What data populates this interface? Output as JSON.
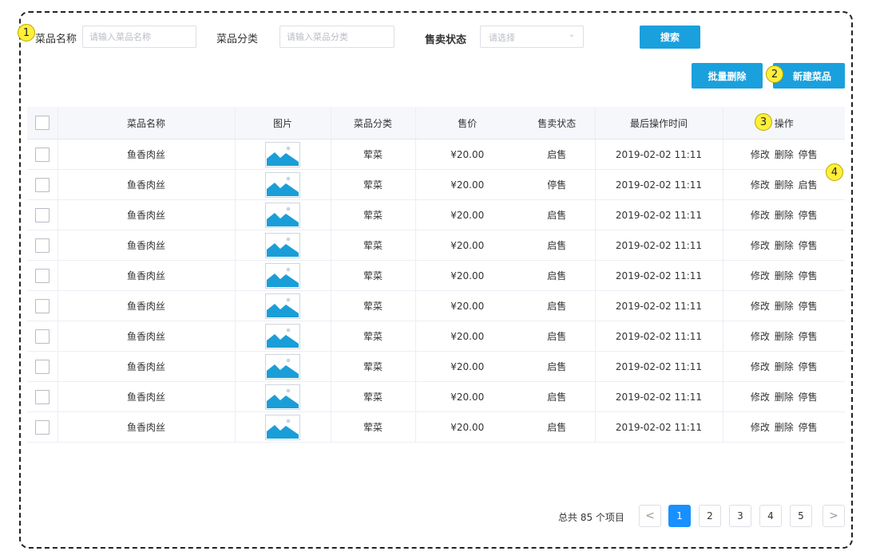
{
  "search": {
    "dish_name_label": "菜品名称",
    "dish_name_placeholder": "请输入菜品名称",
    "category_label": "菜品分类",
    "category_placeholder": "请输入菜品分类",
    "status_label": "售卖状态",
    "status_placeholder": "请选择",
    "search_button": "搜索"
  },
  "actions": {
    "batch_delete": "批量删除",
    "new_dish": "新建菜品"
  },
  "markers": [
    "1",
    "2",
    "3",
    "4"
  ],
  "table": {
    "headers": {
      "name": "菜品名称",
      "image": "图片",
      "category": "菜品分类",
      "price": "售价",
      "status": "售卖状态",
      "updated": "最后操作时间",
      "ops": "操作"
    },
    "rows": [
      {
        "name": "鱼香肉丝",
        "category": "荤菜",
        "price": "¥20.00",
        "status": "启售",
        "updated": "2019-02-02 11:11",
        "op_edit": "修改",
        "op_delete": "删除",
        "op_toggle": "停售"
      },
      {
        "name": "鱼香肉丝",
        "category": "荤菜",
        "price": "¥20.00",
        "status": "停售",
        "updated": "2019-02-02 11:11",
        "op_edit": "修改",
        "op_delete": "删除",
        "op_toggle": "启售"
      },
      {
        "name": "鱼香肉丝",
        "category": "荤菜",
        "price": "¥20.00",
        "status": "启售",
        "updated": "2019-02-02 11:11",
        "op_edit": "修改",
        "op_delete": "删除",
        "op_toggle": "停售"
      },
      {
        "name": "鱼香肉丝",
        "category": "荤菜",
        "price": "¥20.00",
        "status": "启售",
        "updated": "2019-02-02 11:11",
        "op_edit": "修改",
        "op_delete": "删除",
        "op_toggle": "停售"
      },
      {
        "name": "鱼香肉丝",
        "category": "荤菜",
        "price": "¥20.00",
        "status": "启售",
        "updated": "2019-02-02 11:11",
        "op_edit": "修改",
        "op_delete": "删除",
        "op_toggle": "停售"
      },
      {
        "name": "鱼香肉丝",
        "category": "荤菜",
        "price": "¥20.00",
        "status": "启售",
        "updated": "2019-02-02 11:11",
        "op_edit": "修改",
        "op_delete": "删除",
        "op_toggle": "停售"
      },
      {
        "name": "鱼香肉丝",
        "category": "荤菜",
        "price": "¥20.00",
        "status": "启售",
        "updated": "2019-02-02 11:11",
        "op_edit": "修改",
        "op_delete": "删除",
        "op_toggle": "停售"
      },
      {
        "name": "鱼香肉丝",
        "category": "荤菜",
        "price": "¥20.00",
        "status": "启售",
        "updated": "2019-02-02 11:11",
        "op_edit": "修改",
        "op_delete": "删除",
        "op_toggle": "停售"
      },
      {
        "name": "鱼香肉丝",
        "category": "荤菜",
        "price": "¥20.00",
        "status": "启售",
        "updated": "2019-02-02 11:11",
        "op_edit": "修改",
        "op_delete": "删除",
        "op_toggle": "停售"
      },
      {
        "name": "鱼香肉丝",
        "category": "荤菜",
        "price": "¥20.00",
        "status": "启售",
        "updated": "2019-02-02 11:11",
        "op_edit": "修改",
        "op_delete": "删除",
        "op_toggle": "停售"
      }
    ]
  },
  "pagination": {
    "total_text": "总共 85 个项目",
    "prev": "<",
    "next": ">",
    "pages": [
      "1",
      "2",
      "3",
      "4",
      "5"
    ],
    "current_page": "1"
  },
  "colors": {
    "accent": "#1aa0dd",
    "pager_active": "#1890ff",
    "marker": "#ffef3a"
  },
  "icons": {
    "image_placeholder": "image-placeholder-icon",
    "select_chevron": "chevron-down-icon"
  }
}
